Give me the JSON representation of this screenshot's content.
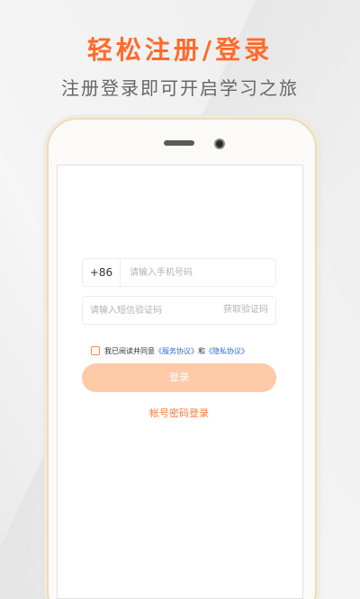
{
  "promo": {
    "title": "轻松注册/登录",
    "subtitle": "注册登录即可开启学习之旅"
  },
  "form": {
    "country_code": "+86",
    "phone_placeholder": "请输入手机号码",
    "code_placeholder": "请输入短信验证码",
    "get_code_label": "获取验证码",
    "agreement": {
      "prefix": "我已阅读并同意",
      "service_link": "《服务协议》",
      "and": "和",
      "privacy_link": "《隐私协议》"
    },
    "login_label": "登录",
    "password_login_label": "帐号密码登录"
  },
  "colors": {
    "accent": "#ff6a2b",
    "button_disabled": "#ffcaa8",
    "link": "#2d6bd2"
  }
}
